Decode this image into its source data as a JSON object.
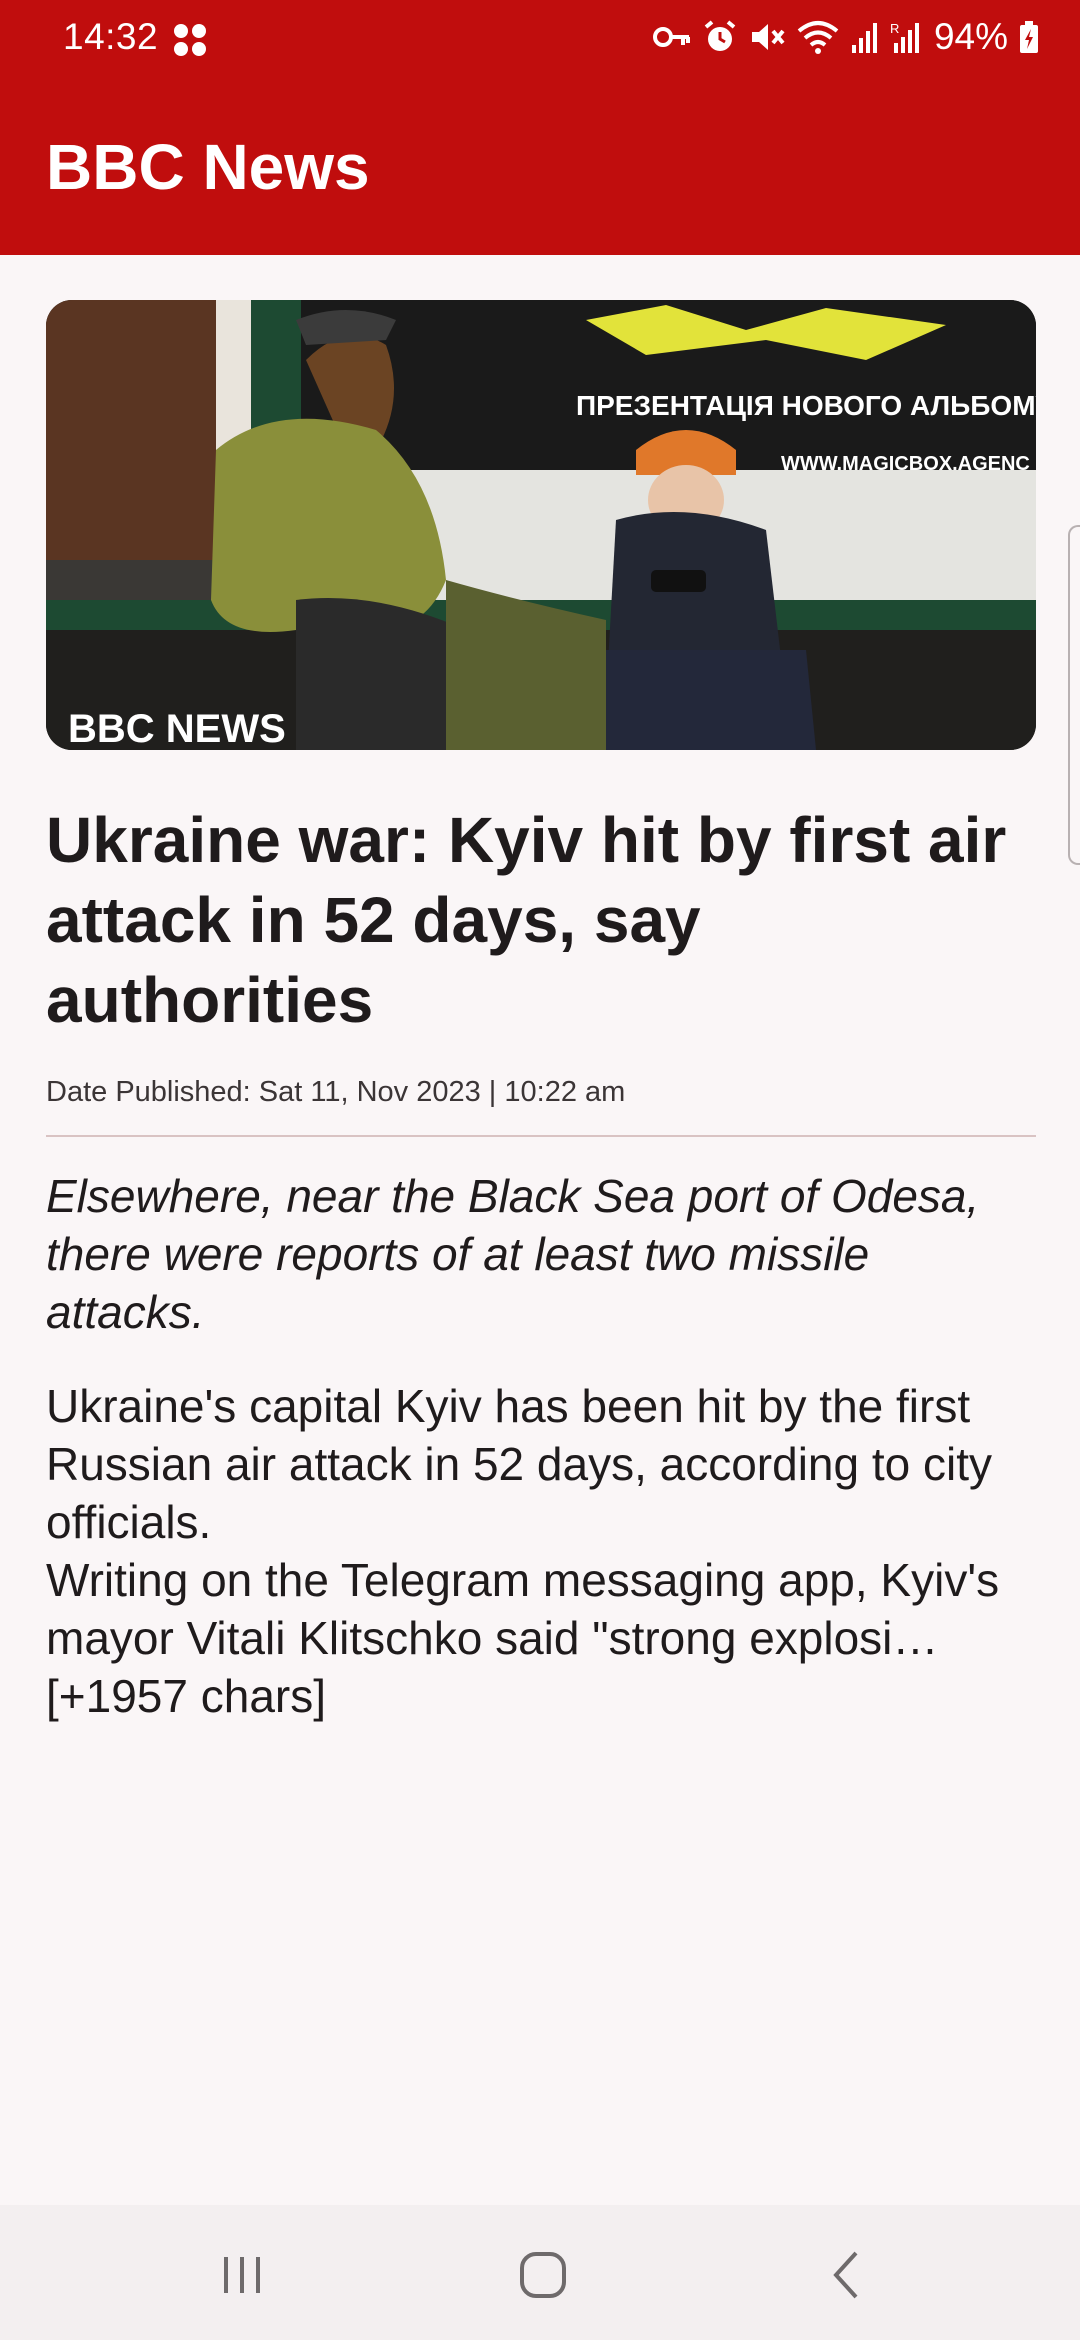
{
  "status_bar": {
    "time": "14:32",
    "battery": "94%",
    "icons": [
      "notification-dots-icon",
      "vpn-key-icon",
      "alarm-icon",
      "mute-icon",
      "wifi-icon",
      "signal-icon",
      "roaming-signal-icon",
      "battery-charging-icon"
    ]
  },
  "app_bar": {
    "title": "BBC News",
    "color": "#c00d0d"
  },
  "article": {
    "image_alt": "Woman in olive jacket and child in orange hat sitting in Kyiv metro station",
    "image_watermark": "BBC NEWS",
    "image_poster_text_1": "ПРЕЗЕНТАЦІЯ НОВОГО АЛЬБОМУ",
    "image_poster_text_2": "WWW.MAGICBOX.AGENC",
    "headline": "Ukraine war: Kyiv hit by first air attack in 52 days, say authorities",
    "date": "Date Published: Sat 11, Nov 2023 | 10:22 am",
    "summary": "Elsewhere, near the Black Sea port of Odesa, there were reports of at least two missile attacks.",
    "body": "Ukraine's capital Kyiv has been hit by the first Russian air attack in 52 days, according to city officials.\nWriting on the Telegram messaging app, Kyiv's mayor Vitali Klitschko said \"strong explosi… [+1957 chars]"
  },
  "nav_bar": {
    "buttons": [
      "recent-apps-icon",
      "home-icon",
      "back-icon"
    ]
  }
}
